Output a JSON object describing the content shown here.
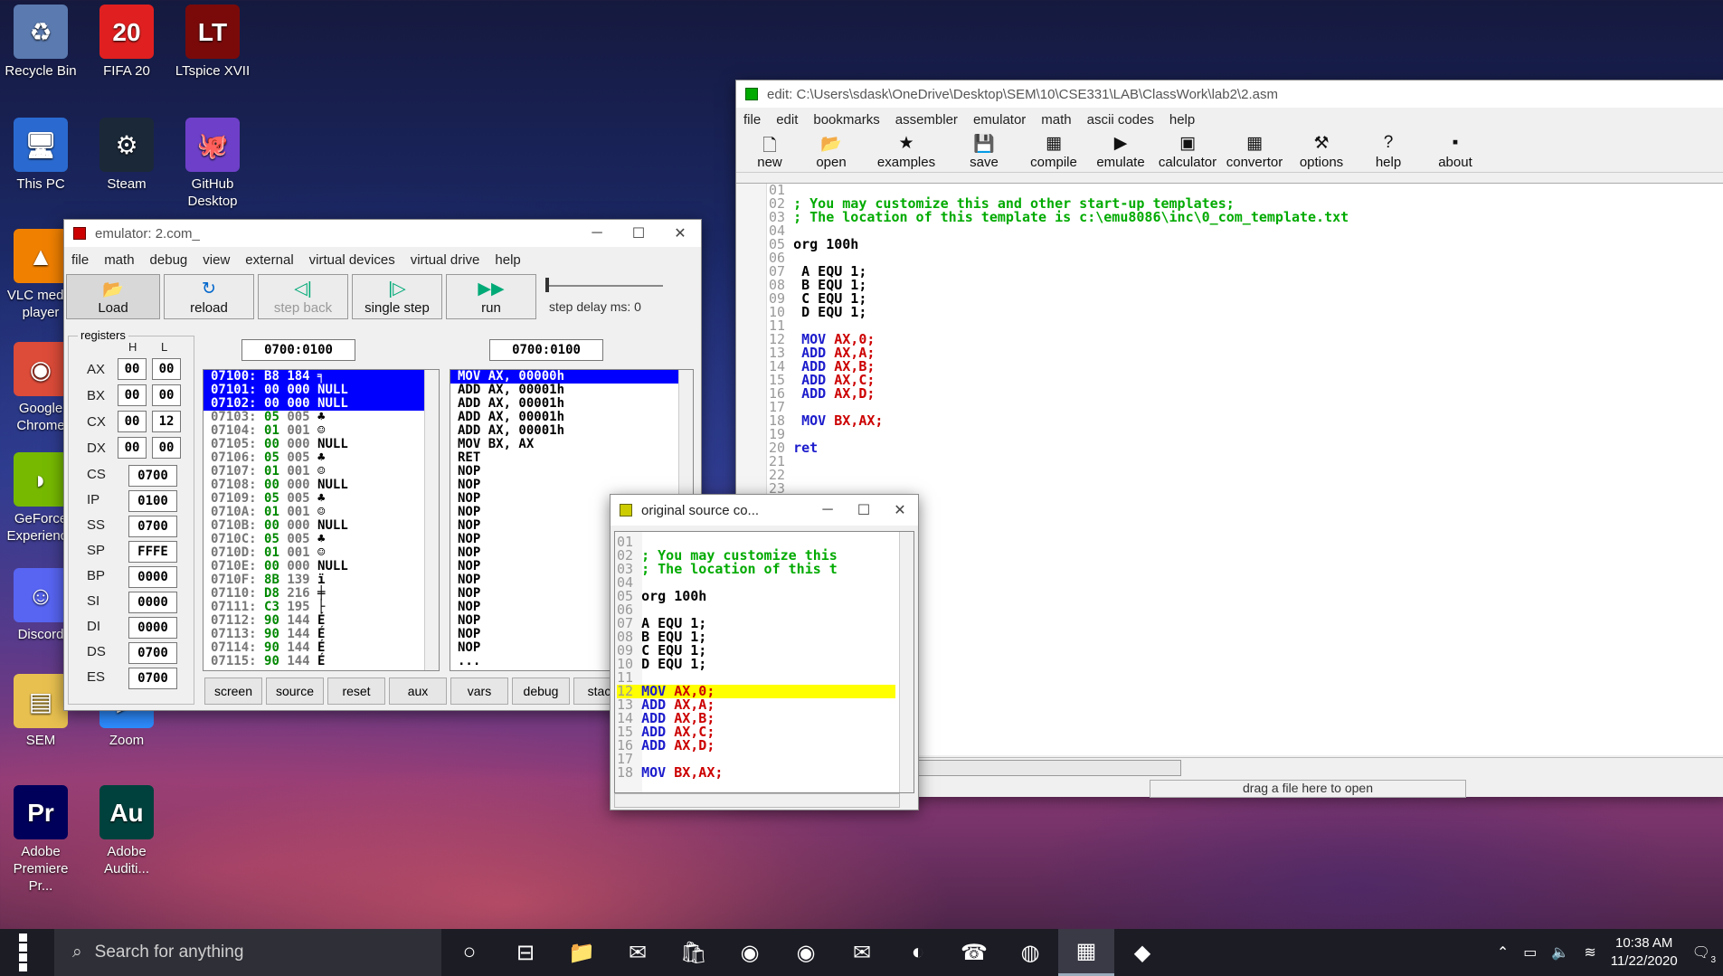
{
  "desktop": {
    "icons": [
      {
        "label": "Recycle Bin",
        "glyph": "♻",
        "bg": "#5a7ab0"
      },
      {
        "label": "FIFA 20",
        "glyph": "20",
        "bg": "#e02020"
      },
      {
        "label": "LTspice XVII",
        "glyph": "LT",
        "bg": "#7a0a0a"
      },
      {
        "label": "This PC",
        "glyph": "🖥",
        "bg": "#2a6ad0"
      },
      {
        "label": "Steam",
        "glyph": "⚙",
        "bg": "#1b2838"
      },
      {
        "label": "GitHub Desktop",
        "glyph": "🐙",
        "bg": "#6e40c9"
      },
      {
        "label": "VLC media player",
        "glyph": "▲",
        "bg": "#f08000"
      },
      {
        "label": "Google Chrome",
        "glyph": "◉",
        "bg": "#dd4b39"
      },
      {
        "label": "GeForce Experience",
        "glyph": "◗",
        "bg": "#76b900"
      },
      {
        "label": "Discord",
        "glyph": "☺",
        "bg": "#5865f2"
      },
      {
        "label": "SEM",
        "glyph": "▤",
        "bg": "#e8c050"
      },
      {
        "label": "Zoom",
        "glyph": "▶",
        "bg": "#2d8cff"
      },
      {
        "label": "Adobe Premiere Pr...",
        "glyph": "Pr",
        "bg": "#00005b"
      },
      {
        "label": "Adobe Auditi...",
        "glyph": "Au",
        "bg": "#00413d"
      }
    ]
  },
  "editor": {
    "title": "edit: C:\\Users\\sdask\\OneDrive\\Desktop\\SEM\\10\\CSE331\\LAB\\ClassWork\\lab2\\2.asm",
    "menu": [
      "file",
      "edit",
      "bookmarks",
      "assembler",
      "emulator",
      "math",
      "ascii codes",
      "help"
    ],
    "toolbar": [
      {
        "label": "new",
        "icon": "🗋"
      },
      {
        "label": "open",
        "icon": "📂"
      },
      {
        "label": "examples",
        "icon": "★"
      },
      {
        "label": "save",
        "icon": "💾"
      },
      {
        "label": "compile",
        "icon": "▦"
      },
      {
        "label": "emulate",
        "icon": "▶"
      },
      {
        "label": "calculator",
        "icon": "▣"
      },
      {
        "label": "convertor",
        "icon": "▦"
      },
      {
        "label": "options",
        "icon": "⚒"
      },
      {
        "label": "help",
        "icon": "?"
      },
      {
        "label": "about",
        "icon": "▪"
      }
    ],
    "status_hint": "drag a file here to open",
    "lines": [
      {
        "n": "01",
        "t": ""
      },
      {
        "n": "02",
        "t": "; You may customize this and other start-up templates;",
        "c": "cm"
      },
      {
        "n": "03",
        "t": "; The location of this template is c:\\emu8086\\inc\\0_com_template.txt",
        "c": "cm"
      },
      {
        "n": "04",
        "t": ""
      },
      {
        "n": "05",
        "t": "org 100h",
        "c": "nm"
      },
      {
        "n": "06",
        "t": ""
      },
      {
        "n": "07",
        "t": " A EQU 1;",
        "c": "nm"
      },
      {
        "n": "08",
        "t": " B EQU 1;",
        "c": "nm"
      },
      {
        "n": "09",
        "t": " C EQU 1;",
        "c": "nm"
      },
      {
        "n": "10",
        "t": " D EQU 1;",
        "c": "nm"
      },
      {
        "n": "11",
        "t": ""
      },
      {
        "n": "12",
        "t": " MOV AX,0;",
        "c": "kw"
      },
      {
        "n": "13",
        "t": " ADD AX,A;",
        "c": "kw"
      },
      {
        "n": "14",
        "t": " ADD AX,B;",
        "c": "kw"
      },
      {
        "n": "15",
        "t": " ADD AX,C;",
        "c": "kw"
      },
      {
        "n": "16",
        "t": " ADD AX,D;",
        "c": "kw"
      },
      {
        "n": "17",
        "t": ""
      },
      {
        "n": "18",
        "t": " MOV BX,AX;",
        "c": "kw"
      },
      {
        "n": "19",
        "t": ""
      },
      {
        "n": "20",
        "t": "ret",
        "c": "kw"
      },
      {
        "n": "21",
        "t": ""
      },
      {
        "n": "22",
        "t": ""
      },
      {
        "n": "23",
        "t": ""
      }
    ]
  },
  "emulator": {
    "title": "emulator: 2.com_",
    "menu": [
      "file",
      "math",
      "debug",
      "view",
      "external",
      "virtual devices",
      "virtual drive",
      "help"
    ],
    "toolbar": [
      {
        "label": "Load",
        "icon": "📂"
      },
      {
        "label": "reload",
        "icon": "↻"
      },
      {
        "label": "step back",
        "icon": "◁|"
      },
      {
        "label": "single step",
        "icon": "|▷"
      },
      {
        "label": "run",
        "icon": "▶▶"
      }
    ],
    "step_delay": "step delay ms: 0",
    "registers_label": "registers",
    "h_label": "H",
    "l_label": "L",
    "regs8": [
      {
        "n": "AX",
        "h": "00",
        "l": "00"
      },
      {
        "n": "BX",
        "h": "00",
        "l": "00"
      },
      {
        "n": "CX",
        "h": "00",
        "l": "12"
      },
      {
        "n": "DX",
        "h": "00",
        "l": "00"
      }
    ],
    "regs16": [
      {
        "n": "CS",
        "v": "0700"
      },
      {
        "n": "IP",
        "v": "0100"
      },
      {
        "n": "SS",
        "v": "0700"
      },
      {
        "n": "SP",
        "v": "FFFE"
      },
      {
        "n": "BP",
        "v": "0000"
      },
      {
        "n": "SI",
        "v": "0000"
      },
      {
        "n": "DI",
        "v": "0000"
      },
      {
        "n": "DS",
        "v": "0700"
      },
      {
        "n": "ES",
        "v": "0700"
      }
    ],
    "addr_left": "0700:0100",
    "addr_right": "0700:0100",
    "memory": [
      {
        "a": "07100:",
        "h": "B8",
        "d": "184",
        "c": "╕",
        "sel": true
      },
      {
        "a": "07101:",
        "h": "00",
        "d": "000",
        "c": "NULL",
        "sel": true
      },
      {
        "a": "07102:",
        "h": "00",
        "d": "000",
        "c": "NULL",
        "sel": true
      },
      {
        "a": "07103:",
        "h": "05",
        "d": "005",
        "c": "♣"
      },
      {
        "a": "07104:",
        "h": "01",
        "d": "001",
        "c": "☺"
      },
      {
        "a": "07105:",
        "h": "00",
        "d": "000",
        "c": "NULL"
      },
      {
        "a": "07106:",
        "h": "05",
        "d": "005",
        "c": "♣"
      },
      {
        "a": "07107:",
        "h": "01",
        "d": "001",
        "c": "☺"
      },
      {
        "a": "07108:",
        "h": "00",
        "d": "000",
        "c": "NULL"
      },
      {
        "a": "07109:",
        "h": "05",
        "d": "005",
        "c": "♣"
      },
      {
        "a": "0710A:",
        "h": "01",
        "d": "001",
        "c": "☺"
      },
      {
        "a": "0710B:",
        "h": "00",
        "d": "000",
        "c": "NULL"
      },
      {
        "a": "0710C:",
        "h": "05",
        "d": "005",
        "c": "♣"
      },
      {
        "a": "0710D:",
        "h": "01",
        "d": "001",
        "c": "☺"
      },
      {
        "a": "0710E:",
        "h": "00",
        "d": "000",
        "c": "NULL"
      },
      {
        "a": "0710F:",
        "h": "8B",
        "d": "139",
        "c": "ï"
      },
      {
        "a": "07110:",
        "h": "D8",
        "d": "216",
        "c": "╪"
      },
      {
        "a": "07111:",
        "h": "C3",
        "d": "195",
        "c": "├"
      },
      {
        "a": "07112:",
        "h": "90",
        "d": "144",
        "c": "É"
      },
      {
        "a": "07113:",
        "h": "90",
        "d": "144",
        "c": "É"
      },
      {
        "a": "07114:",
        "h": "90",
        "d": "144",
        "c": "É"
      },
      {
        "a": "07115:",
        "h": "90",
        "d": "144",
        "c": "É"
      }
    ],
    "disasm": [
      "MOV AX, 00000h",
      "ADD AX, 00001h",
      "ADD AX, 00001h",
      "ADD AX, 00001h",
      "ADD AX, 00001h",
      "MOV BX, AX",
      "RET",
      "NOP",
      "NOP",
      "NOP",
      "NOP",
      "NOP",
      "NOP",
      "NOP",
      "NOP",
      "NOP",
      "NOP",
      "NOP",
      "NOP",
      "NOP",
      "NOP",
      "..."
    ],
    "bottom_buttons": [
      "screen",
      "source",
      "reset",
      "aux",
      "vars",
      "debug",
      "stack"
    ]
  },
  "source": {
    "title": "original source co...",
    "lines": [
      {
        "n": "01",
        "t": ""
      },
      {
        "n": "02",
        "t": "; You may customize this",
        "c": "cm"
      },
      {
        "n": "03",
        "t": "; The location of this t",
        "c": "cm"
      },
      {
        "n": "04",
        "t": ""
      },
      {
        "n": "05",
        "t": "org 100h",
        "c": "nm"
      },
      {
        "n": "06",
        "t": ""
      },
      {
        "n": "07",
        "t": "A EQU 1;",
        "c": "nm"
      },
      {
        "n": "08",
        "t": "B EQU 1;",
        "c": "nm"
      },
      {
        "n": "09",
        "t": "C EQU 1;",
        "c": "nm"
      },
      {
        "n": "10",
        "t": "D EQU 1;",
        "c": "nm"
      },
      {
        "n": "11",
        "t": ""
      },
      {
        "n": "12",
        "t": "MOV AX,0;",
        "c": "kw",
        "hl": true
      },
      {
        "n": "13",
        "t": "ADD AX,A;",
        "c": "kw"
      },
      {
        "n": "14",
        "t": "ADD AX,B;",
        "c": "kw"
      },
      {
        "n": "15",
        "t": "ADD AX,C;",
        "c": "kw"
      },
      {
        "n": "16",
        "t": "ADD AX,D;",
        "c": "kw"
      },
      {
        "n": "17",
        "t": ""
      },
      {
        "n": "18",
        "t": "MOV BX,AX;",
        "c": "kw"
      }
    ]
  },
  "taskbar": {
    "search_placeholder": "Search for anything",
    "time": "10:38 AM",
    "date": "11/22/2020",
    "notif_count": "3",
    "apps": [
      "○",
      "⊟",
      "📁",
      "✉",
      "🛍",
      "◉",
      "◉",
      "✉",
      "◐",
      "☎",
      "◍",
      "▦",
      "◆"
    ]
  }
}
